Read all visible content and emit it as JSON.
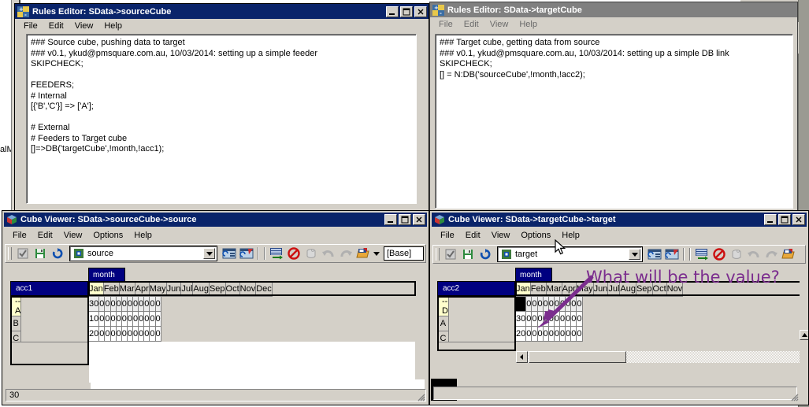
{
  "background": {
    "left_fragment_text": "alMc"
  },
  "windows": {
    "rules_editor_source": {
      "title": "Rules Editor:  SData->sourceCube",
      "icon": "rules-editor-icon",
      "active": true,
      "menus": [
        "File",
        "Edit",
        "View",
        "Help"
      ],
      "content": "### Source cube, pushing data to target\n### v0.1, ykud@pmsquare.com.au, 10/03/2014: setting up a simple feeder\nSKIPCHECK;\n\nFEEDERS;\n# Internal\n[{'B','C'}] => ['A'];\n\n# External\n# Feeders to Target cube\n[]=>DB('targetCube',!month,!acc1);",
      "buttons": {
        "minimize": "_",
        "maximize": "□",
        "close": "✕"
      }
    },
    "rules_editor_target": {
      "title": "Rules Editor:  SData->targetCube",
      "icon": "rules-editor-icon",
      "active": false,
      "menus": [
        "File",
        "Edit",
        "View",
        "Help"
      ],
      "content": "### Target cube, getting data from source\n### v0.1, ykud@pmsquare.com.au, 10/03/2014: setting up a simple DB link\nSKIPCHECK;\n[] = N:DB('sourceCube',!month,!acc2);"
    },
    "cube_viewer_source": {
      "title": "Cube Viewer: SData->sourceCube->source",
      "icon": "cube-icon",
      "active": true,
      "menus": [
        "File",
        "Edit",
        "View",
        "Options",
        "Help"
      ],
      "toolbar": {
        "view_name": "source",
        "base_label": "[Base]",
        "icons": [
          "checkmark-icon",
          "save-icon",
          "recalculate-icon",
          "edit-view-icon",
          "edit-formula-icon",
          "columns-icon",
          "export-grid-icon",
          "suppress-zeros-icon",
          "drill-icon",
          "undo-icon",
          "redo-icon",
          "open-view-icon"
        ]
      },
      "grid": {
        "column_dimension": "month",
        "row_dimension": "acc1",
        "columns": [
          "Jan",
          "Feb",
          "Mar",
          "Apr",
          "May",
          "Jun",
          "Jul",
          "Aug",
          "Sep",
          "Oct",
          "Nov",
          "Dec"
        ],
        "selected_column": "Jan",
        "rows": [
          {
            "label": "-- A",
            "selected": true,
            "values": [
              "30",
              "0",
              "0",
              "0",
              "0",
              "0",
              "0",
              "0",
              "0",
              "0",
              "0",
              "0"
            ]
          },
          {
            "label": "B",
            "selected": false,
            "values": [
              "10",
              "0",
              "0",
              "0",
              "0",
              "0",
              "0",
              "0",
              "0",
              "0",
              "0",
              "0"
            ]
          },
          {
            "label": "C",
            "selected": false,
            "values": [
              "20",
              "0",
              "0",
              "0",
              "0",
              "0",
              "0",
              "0",
              "0",
              "0",
              "0",
              "0"
            ]
          }
        ]
      },
      "statusbar": "30"
    },
    "cube_viewer_target": {
      "title": "Cube Viewer: SData->targetCube->target",
      "icon": "cube-icon",
      "active": true,
      "menus": [
        "File",
        "Edit",
        "View",
        "Options",
        "Help"
      ],
      "toolbar": {
        "view_name": "target",
        "icons": [
          "checkmark-icon",
          "save-icon",
          "recalculate-icon",
          "edit-view-icon",
          "edit-formula-icon",
          "columns-icon",
          "export-grid-icon",
          "suppress-zeros-icon",
          "drill-icon",
          "undo-icon",
          "redo-icon",
          "open-view-icon"
        ]
      },
      "grid": {
        "column_dimension": "month",
        "row_dimension": "acc2",
        "columns": [
          "Jan",
          "Feb",
          "Mar",
          "Apr",
          "May",
          "Jun",
          "Jul",
          "Aug",
          "Sep",
          "Oct",
          "Nov"
        ],
        "selected_column": "Jan",
        "rows": [
          {
            "label": "-- D",
            "selected": true,
            "values": [
              "",
              "0",
              "0",
              "0",
              "0",
              "0",
              "0",
              "0",
              "0",
              "0",
              "0"
            ],
            "first_cell_black": true
          },
          {
            "label": "A",
            "selected": false,
            "values": [
              "30",
              "0",
              "0",
              "0",
              "0",
              "0",
              "0",
              "0",
              "0",
              "0",
              "0"
            ]
          },
          {
            "label": "C",
            "selected": false,
            "values": [
              "20",
              "0",
              "0",
              "0",
              "0",
              "0",
              "0",
              "0",
              "0",
              "0",
              "0"
            ]
          }
        ]
      },
      "statusbar": ""
    }
  },
  "annotation": {
    "text": "What will be the value?",
    "color": "#7b2d8e",
    "arrow": "arrow-pointing-to-jan-d-cell"
  }
}
